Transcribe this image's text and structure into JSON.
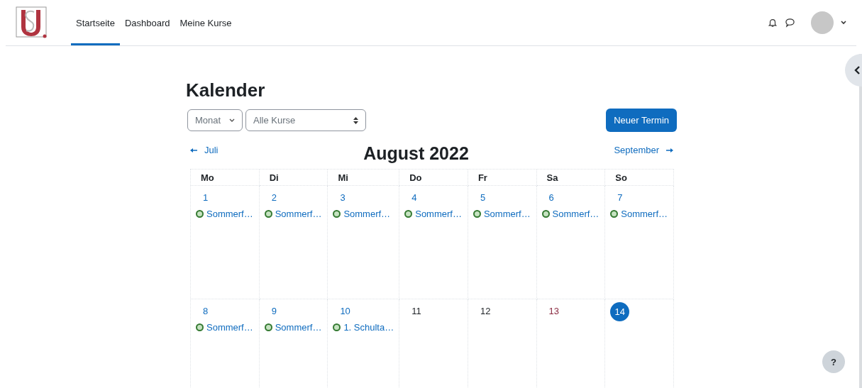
{
  "nav": {
    "items": [
      {
        "label": "Startseite",
        "selected": true
      },
      {
        "label": "Dashboard",
        "selected": false
      },
      {
        "label": "Meine Kurse",
        "selected": false
      }
    ]
  },
  "page_title": "Kalender",
  "view_select": {
    "value": "Monat"
  },
  "course_select": {
    "value": "Alle Kurse"
  },
  "new_event_button": "Neuer Termin",
  "prev_month": "Juli",
  "month_title": "August 2022",
  "next_month": "September",
  "weekdays": [
    "Mo",
    "Di",
    "Mi",
    "Do",
    "Fr",
    "Sa",
    "So"
  ],
  "weeks": [
    {
      "days": [
        {
          "number": "1",
          "today": false,
          "events": [
            "Sommerf…"
          ]
        },
        {
          "number": "2",
          "today": false,
          "events": [
            "Sommerf…"
          ]
        },
        {
          "number": "3",
          "today": false,
          "events": [
            "Sommerf…"
          ]
        },
        {
          "number": "4",
          "today": false,
          "events": [
            "Sommerf…"
          ]
        },
        {
          "number": "5",
          "today": false,
          "events": [
            "Sommerf…"
          ]
        },
        {
          "number": "6",
          "today": false,
          "events": [
            "Sommerf…"
          ]
        },
        {
          "number": "7",
          "today": false,
          "events": [
            "Sommerf…"
          ]
        }
      ]
    },
    {
      "days": [
        {
          "number": "8",
          "today": false,
          "events": [
            "Sommerf…"
          ]
        },
        {
          "number": "9",
          "today": false,
          "events": [
            "Sommerf…"
          ]
        },
        {
          "number": "10",
          "today": false,
          "events": [
            "1. Schulta…"
          ]
        },
        {
          "number": "11",
          "today": false,
          "weekend": false
        },
        {
          "number": "12",
          "today": false,
          "weekend": false
        },
        {
          "number": "13",
          "today": false,
          "weekend": true
        },
        {
          "number": "14",
          "today": true
        }
      ]
    }
  ],
  "help_button": "?"
}
